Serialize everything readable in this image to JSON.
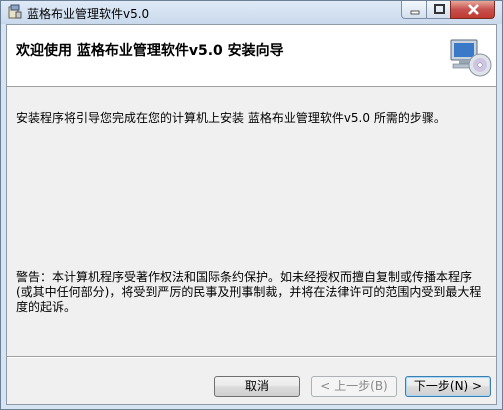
{
  "window": {
    "title": "蓝格布业管理软件v5.0"
  },
  "header": {
    "heading": "欢迎使用 蓝格布业管理软件v5.0 安装向导"
  },
  "content": {
    "intro": "安装程序将引导您完成在您的计算机上安装 蓝格布业管理软件v5.0 所需的步骤。",
    "warning": "警告：本计算机程序受著作权法和国际条约保护。如未经授权而擅自复制或传播本程序(或其中任何部分)，将受到严厉的民事及刑事制裁，并将在法律许可的范围内受到最大程度的起诉。"
  },
  "buttons": {
    "cancel": "取消",
    "back": "< 上一步(B)",
    "next": "下一步(N) >"
  }
}
